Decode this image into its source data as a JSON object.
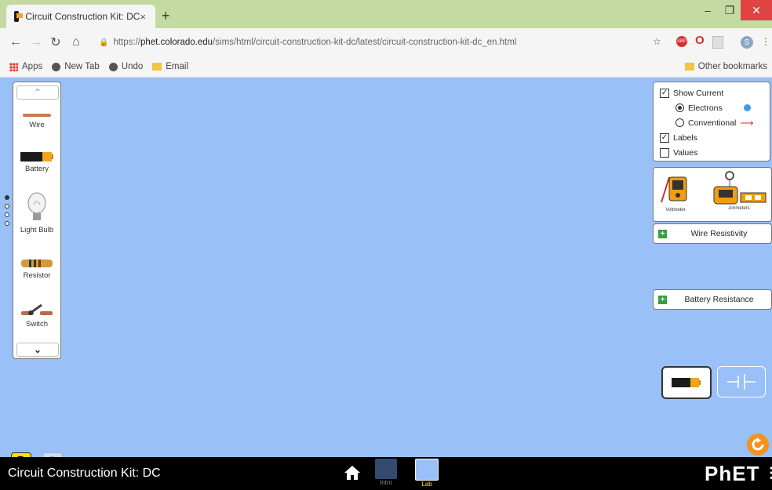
{
  "browser": {
    "tab_title": "Circuit Construction Kit: DC",
    "tab_close": "×",
    "new_tab": "+",
    "url_prefix": "https://",
    "url_host": "phet.colorado.edu",
    "url_path": "/sims/html/circuit-construction-kit-dc/latest/circuit-construction-kit-dc_en.html",
    "bookmarks": [
      "Apps",
      "New Tab",
      "Undo",
      "Email"
    ],
    "other_bookmarks": "Other bookmarks",
    "profile_initial": "S"
  },
  "toolbox": {
    "items": [
      {
        "label": "Wire"
      },
      {
        "label": "Battery"
      },
      {
        "label": "Light Bulb"
      },
      {
        "label": "Resistor"
      },
      {
        "label": "Switch"
      }
    ]
  },
  "options_panel": {
    "show_current": {
      "label": "Show Current",
      "checked": true
    },
    "electrons": {
      "label": "Electrons",
      "selected": true
    },
    "conventional": {
      "label": "Conventional",
      "selected": false
    },
    "labels": {
      "label": "Labels",
      "checked": true
    },
    "values": {
      "label": "Values",
      "checked": false
    }
  },
  "sensors": {
    "voltmeter": "Voltmeter",
    "ammeters": "Ammeters"
  },
  "accordions": {
    "wire_resistivity": "Wire Resistivity",
    "battery_resistance": "Battery Resistance"
  },
  "navbar": {
    "sim_title": "Circuit Construction Kit: DC",
    "screens": [
      "Intro",
      "Lab"
    ],
    "brand": "PhET"
  },
  "colors": {
    "play_area": "#99c1f7",
    "accent_yellow": "#ffe000",
    "reset_orange": "#f5911e"
  }
}
